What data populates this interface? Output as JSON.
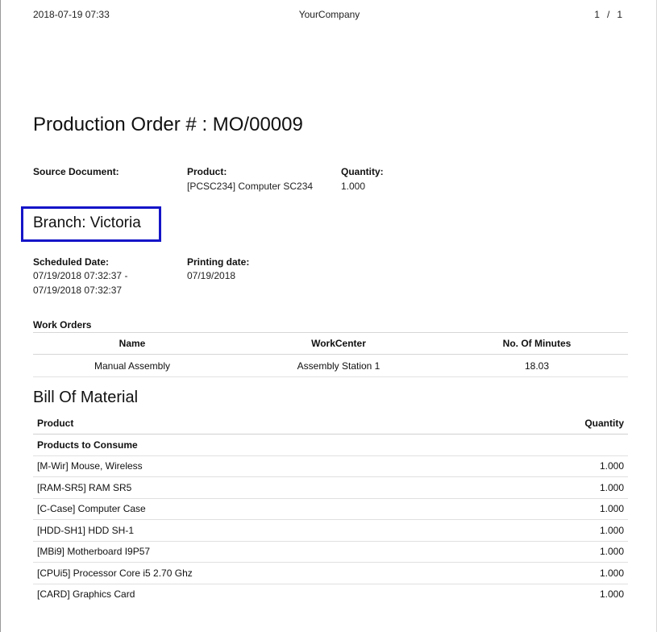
{
  "header": {
    "datetime": "2018-07-19 07:33",
    "company": "YourCompany",
    "page_current": "1",
    "page_sep": "/",
    "page_total": "1"
  },
  "title": "Production Order # : MO/00009",
  "info": {
    "source_document_label": "Source Document:",
    "source_document_value": "",
    "product_label": "Product:",
    "product_value": "[PCSC234] Computer SC234",
    "quantity_label": "Quantity:",
    "quantity_value": "1.000"
  },
  "branch": {
    "text": "Branch: Victoria",
    "highlight_color": "#1515c8"
  },
  "dates": {
    "scheduled_label": "Scheduled Date:",
    "scheduled_line1": "07/19/2018 07:32:37 -",
    "scheduled_line2": "07/19/2018 07:32:37",
    "printing_label": "Printing date:",
    "printing_value": "07/19/2018"
  },
  "work_orders": {
    "label": "Work Orders",
    "columns": [
      "Name",
      "WorkCenter",
      "No. Of Minutes"
    ],
    "rows": [
      [
        "Manual Assembly",
        "Assembly Station 1",
        "18.03"
      ]
    ]
  },
  "bom": {
    "title": "Bill Of Material",
    "col_product": "Product",
    "col_quantity": "Quantity",
    "group_label": "Products to Consume",
    "items": [
      {
        "product": "[M-Wir] Mouse, Wireless",
        "quantity": "1.000"
      },
      {
        "product": "[RAM-SR5] RAM SR5",
        "quantity": "1.000"
      },
      {
        "product": "[C-Case] Computer Case",
        "quantity": "1.000"
      },
      {
        "product": "[HDD-SH1] HDD SH-1",
        "quantity": "1.000"
      },
      {
        "product": "[MBi9] Motherboard I9P57",
        "quantity": "1.000"
      },
      {
        "product": "[CPUi5] Processor Core i5 2.70 Ghz",
        "quantity": "1.000"
      },
      {
        "product": "[CARD] Graphics Card",
        "quantity": "1.000"
      }
    ]
  }
}
